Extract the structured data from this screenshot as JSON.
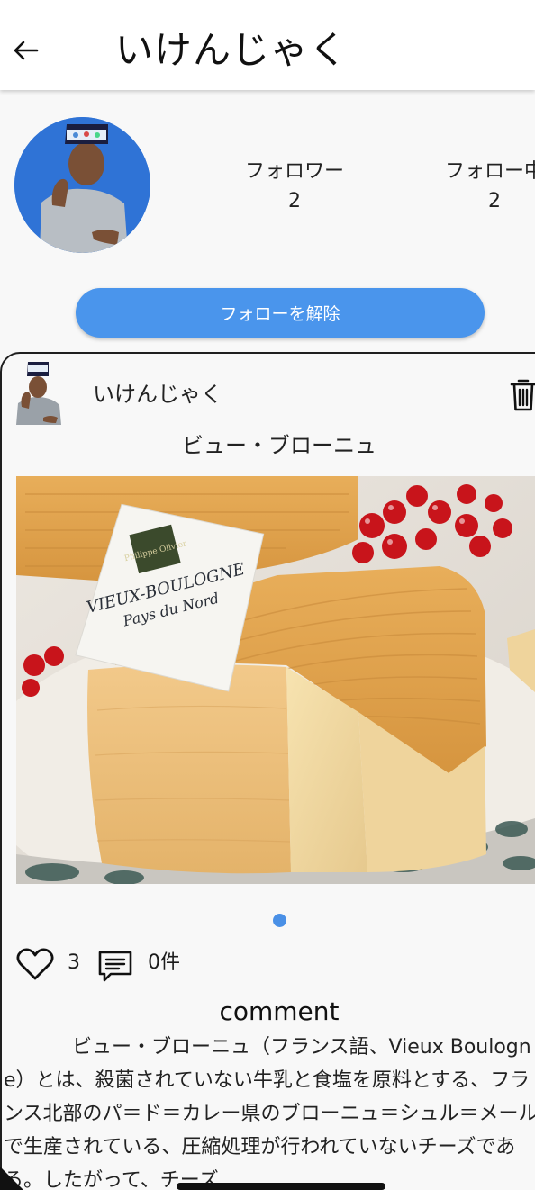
{
  "header": {
    "back_icon": "arrow-left-icon",
    "title": "いけんじゃく"
  },
  "profile": {
    "avatar": "user-avatar-photo",
    "followers_label": "フォロワー",
    "followers_count": "2",
    "following_label": "フォロー中",
    "following_count": "2",
    "unfollow_label": "フォローを解除"
  },
  "post": {
    "username": "いけんじゃく",
    "delete_icon": "trash-icon",
    "title": "ビュー・ブローニュ",
    "image": {
      "card_lines": [
        "VIEUX-BOULOGNE",
        "Pays du Nord"
      ],
      "card_logo": "Philippe Olivier"
    },
    "carousel_page": "1 of 1",
    "like_icon": "heart-icon",
    "like_count": "3",
    "comment_icon": "comment-icon",
    "comment_count": "0件",
    "comment_heading": "comment",
    "description": "ビュー・ブローニュ（フランス語、Vieux Boulogne）とは、殺菌されていない牛乳と食塩を原料とする、フランス北部のパ＝ド＝カレー県のブローニュ＝シュル＝メールで生産されている、圧縮処理が行われていないチーズである。したがって、チーズ"
  },
  "colors": {
    "accent": "#4a95ec",
    "background": "#f8f8f8",
    "avatar_bg": "#2f73d6"
  }
}
